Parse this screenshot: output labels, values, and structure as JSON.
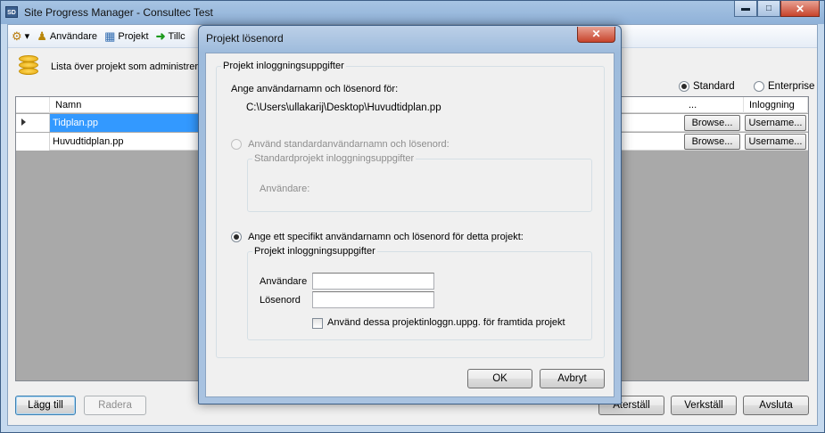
{
  "window": {
    "icon_text": "SD",
    "title": "Site Progress Manager - Consultec Test",
    "minimize": "▬",
    "maximize": "□",
    "close": "✕"
  },
  "toolbar": {
    "settings_arrow": "▾",
    "users_label": "Användare",
    "projects_label": "Projekt",
    "add_label": "Tillc"
  },
  "header": {
    "list_title": "Lista över projekt som administreras"
  },
  "mode": {
    "standard_label": "Standard",
    "enterprise_label": "Enterprise",
    "selected": "Standard"
  },
  "grid": {
    "columns": [
      "Namn",
      "...",
      "Inloggning"
    ],
    "rows": [
      {
        "name": "Tidplan.pp",
        "browse": "Browse...",
        "login": "Username...",
        "selected": true
      },
      {
        "name": "Huvudtidplan.pp",
        "browse": "Browse...",
        "login": "Username...",
        "selected": false
      }
    ]
  },
  "bottom_buttons": {
    "add": "Lägg till",
    "delete": "Radera",
    "reset": "Återställ",
    "apply": "Verkställ",
    "exit": "Avsluta"
  },
  "dialog": {
    "title": "Projekt lösenord",
    "close": "✕",
    "group_title": "Projekt inloggningsuppgifter",
    "prompt": "Ange användarnamn och lösenord för:",
    "path": "C:\\Users\\ullakarij\\Desktop\\Huvudtidplan.pp",
    "option_default": "Använd standardanvändarnamn och lösenord:",
    "default_group_title": "Standardprojekt inloggningsuppgifter",
    "default_user_label": "Användare:",
    "option_specific": "Ange ett specifikt användarnamn och lösenord för detta projekt:",
    "specific_group_title": "Projekt inloggningsuppgifter",
    "user_label": "Användare",
    "user_value": "",
    "password_label": "Lösenord",
    "password_value": "",
    "remember_label": "Använd dessa projektinloggn.uppg. för framtida projekt",
    "remember_checked": false,
    "ok": "OK",
    "cancel": "Avbryt"
  }
}
